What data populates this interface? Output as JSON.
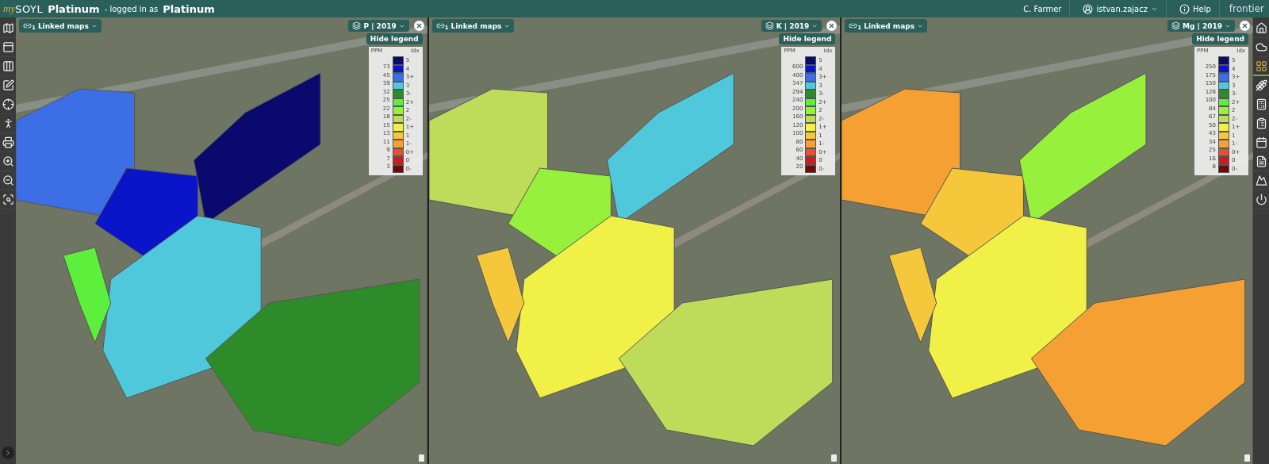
{
  "header": {
    "logo_prefix": "my",
    "logo_main": "SOYL",
    "product": "Platinum",
    "login_text": "- logged in as",
    "login_level": "Platinum",
    "farm": "C. Farmer",
    "user": "istvan.zajacz",
    "help": "Help",
    "brand": "frontier"
  },
  "panels": [
    {
      "linked": {
        "label": "Linked maps",
        "count": "1"
      },
      "layer": "P | 2019",
      "hide_legend": "Hide legend",
      "legend": {
        "unit": "PPM",
        "index_label": "Idx",
        "thresholds": [
          "73",
          "45",
          "39",
          "32",
          "25",
          "22",
          "18",
          "15",
          "13",
          "11",
          "9",
          "7",
          "3"
        ],
        "classes": [
          {
            "label": "5",
            "color": "#0a0a6e"
          },
          {
            "label": "4",
            "color": "#0a14c8"
          },
          {
            "label": "3+",
            "color": "#3c6ee6"
          },
          {
            "label": "3",
            "color": "#50c8dc"
          },
          {
            "label": "3-",
            "color": "#2e8b2a"
          },
          {
            "label": "2+",
            "color": "#5cf03c"
          },
          {
            "label": "2",
            "color": "#96f03c"
          },
          {
            "label": "2-",
            "color": "#bedc5a"
          },
          {
            "label": "1+",
            "color": "#f0f046"
          },
          {
            "label": "1",
            "color": "#f5c83c"
          },
          {
            "label": "1-",
            "color": "#f5a032"
          },
          {
            "label": "0+",
            "color": "#e65032"
          },
          {
            "label": "0",
            "color": "#c81e1e"
          },
          {
            "label": "0-",
            "color": "#6e0a0a"
          }
        ]
      }
    },
    {
      "linked": {
        "label": "Linked maps",
        "count": "1"
      },
      "layer": "K | 2019",
      "hide_legend": "Hide legend",
      "legend": {
        "unit": "PPM",
        "index_label": "Idx",
        "thresholds": [
          "600",
          "400",
          "347",
          "294",
          "240",
          "200",
          "160",
          "120",
          "100",
          "80",
          "60",
          "40",
          "20"
        ],
        "classes": [
          {
            "label": "5",
            "color": "#0a0a6e"
          },
          {
            "label": "4",
            "color": "#0a14c8"
          },
          {
            "label": "3+",
            "color": "#3c6ee6"
          },
          {
            "label": "3",
            "color": "#50c8dc"
          },
          {
            "label": "3-",
            "color": "#2e8b2a"
          },
          {
            "label": "2+",
            "color": "#5cf03c"
          },
          {
            "label": "2",
            "color": "#96f03c"
          },
          {
            "label": "2-",
            "color": "#bedc5a"
          },
          {
            "label": "1+",
            "color": "#f0f046"
          },
          {
            "label": "1",
            "color": "#f5c83c"
          },
          {
            "label": "1-",
            "color": "#f5a032"
          },
          {
            "label": "0+",
            "color": "#e65032"
          },
          {
            "label": "0",
            "color": "#c81e1e"
          },
          {
            "label": "0-",
            "color": "#6e0a0a"
          }
        ]
      }
    },
    {
      "linked": {
        "label": "Linked maps",
        "count": "1"
      },
      "layer": "Mg | 2019",
      "hide_legend": "Hide legend",
      "legend": {
        "unit": "PPM",
        "index_label": "Idx",
        "thresholds": [
          "250",
          "175",
          "150",
          "126",
          "100",
          "84",
          "67",
          "50",
          "43",
          "34",
          "25",
          "16",
          "8"
        ],
        "classes": [
          {
            "label": "5",
            "color": "#0a0a6e"
          },
          {
            "label": "4",
            "color": "#0a14c8"
          },
          {
            "label": "3+",
            "color": "#3c6ee6"
          },
          {
            "label": "3",
            "color": "#50c8dc"
          },
          {
            "label": "3-",
            "color": "#2e8b2a"
          },
          {
            "label": "2+",
            "color": "#5cf03c"
          },
          {
            "label": "2",
            "color": "#96f03c"
          },
          {
            "label": "2-",
            "color": "#bedc5a"
          },
          {
            "label": "1+",
            "color": "#f0f046"
          },
          {
            "label": "1",
            "color": "#f5c83c"
          },
          {
            "label": "1-",
            "color": "#f5a032"
          },
          {
            "label": "0+",
            "color": "#e65032"
          },
          {
            "label": "0",
            "color": "#c81e1e"
          },
          {
            "label": "0-",
            "color": "#6e0a0a"
          }
        ]
      }
    }
  ],
  "right_toolbar": [
    {
      "selected": false
    },
    {
      "selected": false
    },
    {
      "selected": true
    },
    {
      "selected": false
    },
    {
      "selected": false
    },
    {
      "selected": false
    },
    {
      "selected": false
    },
    {
      "selected": false
    },
    {
      "selected": false
    },
    {
      "selected": false
    }
  ]
}
